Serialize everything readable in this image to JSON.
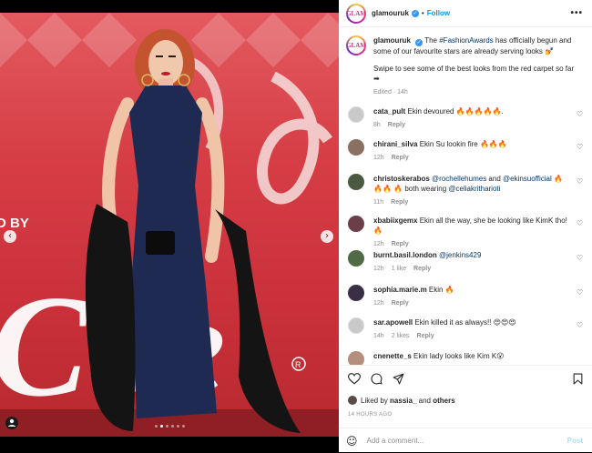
{
  "header": {
    "username": "glamouruk",
    "separator": "•",
    "follow_label": "Follow",
    "more_label": "•••",
    "avatar_text": "GLAM"
  },
  "caption": {
    "username": "glamouruk",
    "text_1": "The ",
    "hashtag": "#FashionAwards",
    "text_2": " has officially begun and some of our favourite stars are already serving looks 💅",
    "line_2": "Swipe to see some of the best looks from the red carpet so far",
    "arrow_emoji": "➡",
    "meta": "Edited · 14h"
  },
  "comments": [
    {
      "username": "cata_pult",
      "text": "Ekin devoured 🔥🔥🔥🔥🔥.",
      "time": "8h",
      "likes": "",
      "reply": "Reply",
      "avatar_color": "#c9c9c9"
    },
    {
      "username": "chirani_silva",
      "text": "Ekin Su lookin fire 🔥🔥🔥",
      "time": "12h",
      "likes": "",
      "reply": "Reply",
      "avatar_color": "#8a7061"
    },
    {
      "username": "christoskerabos",
      "mention_1": "@rochellehumes",
      "mid": " and ",
      "mention_2": "@ekinsuofficial",
      "text_a": " 🔥🔥🔥",
      "text_b": "🔥 both wearing ",
      "mention_3": "@celiakritharioti",
      "time": "11h",
      "likes": "",
      "reply": "Reply",
      "avatar_color": "#4b5a3f"
    },
    {
      "username": "xbabiixgemx",
      "text": "Ekin all the way, she be looking like KimK tho! 🔥",
      "time": "12h",
      "likes": "",
      "reply": "Reply",
      "avatar_color": "#6b3e4a"
    },
    {
      "username": "burnt.basil.london",
      "mention": "@jenkins429",
      "time": "12h",
      "likes": "1 like",
      "reply": "Reply",
      "avatar_color": "#4f6b46"
    },
    {
      "username": "sophia.marie.m",
      "text": "Ekin 🔥",
      "time": "12h",
      "likes": "",
      "reply": "Reply",
      "avatar_color": "#3a2f45"
    },
    {
      "username": "sar.apowell",
      "text": "Ekin killed it as always!! 😍😍😍",
      "time": "14h",
      "likes": "2 likes",
      "reply": "Reply",
      "avatar_color": "#c9c9c9"
    },
    {
      "username": "cnenette_s",
      "text": "Ekin lady looks like Kim K😮",
      "time": "",
      "likes": "",
      "reply": "",
      "avatar_color": "#b58e7e"
    }
  ],
  "liked_by": {
    "prefix": "Liked by ",
    "user": "nassia_",
    "mid": " and ",
    "others": "others"
  },
  "time_ago": "14 HOURS AGO",
  "add_comment": {
    "placeholder": "Add a comment...",
    "post_label": "Post",
    "emoji_icon": "☺"
  },
  "media": {
    "prev_icon": "‹",
    "next_icon": "›",
    "slides": 6,
    "active_slide": 1
  },
  "colors": {
    "accent": "#0095f6",
    "background_red": "#d63d45"
  }
}
